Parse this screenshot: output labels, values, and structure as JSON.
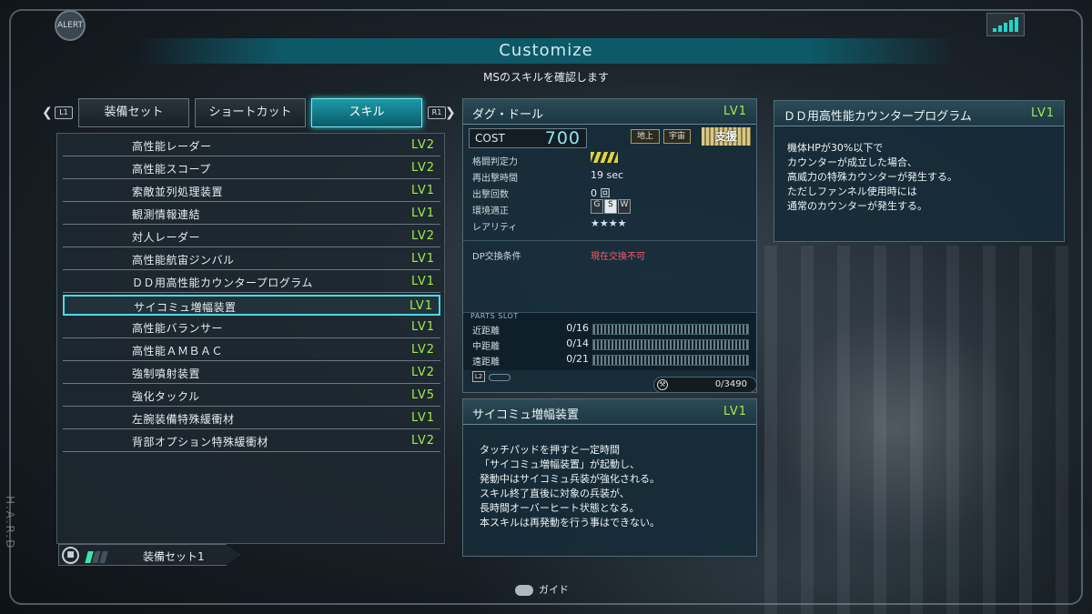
{
  "header": {
    "alert": "ALERT",
    "title": "Customize",
    "subtitle": "MSのスキルを確認します"
  },
  "tabs": {
    "left_button": "L1",
    "right_button": "R1",
    "items": [
      {
        "label": "装備セット"
      },
      {
        "label": "ショートカット"
      },
      {
        "label": "スキル",
        "active": true
      }
    ]
  },
  "skills": [
    {
      "name": "高性能レーダー",
      "level": "LV2"
    },
    {
      "name": "高性能スコープ",
      "level": "LV2"
    },
    {
      "name": "索敵並列処理装置",
      "level": "LV1"
    },
    {
      "name": "観測情報連結",
      "level": "LV1"
    },
    {
      "name": "対人レーダー",
      "level": "LV2"
    },
    {
      "name": "高性能航宙ジンバル",
      "level": "LV1"
    },
    {
      "name": "ＤＤ用高性能カウンタープログラム",
      "level": "LV1"
    },
    {
      "name": "サイコミュ増幅装置",
      "level": "LV1",
      "selected": true
    },
    {
      "name": "高性能バランサー",
      "level": "LV1"
    },
    {
      "name": "高性能ＡＭＢＡＣ",
      "level": "LV2"
    },
    {
      "name": "強制噴射装置",
      "level": "LV2"
    },
    {
      "name": "強化タックル",
      "level": "LV5"
    },
    {
      "name": "左腕装備特殊緩衝材",
      "level": "LV1"
    },
    {
      "name": "背部オプション特殊緩衝材",
      "level": "LV2"
    }
  ],
  "loadout": {
    "label": "装備セット1",
    "filled_bars": 1,
    "total_bars": 3
  },
  "ms": {
    "name": "ダグ・ドール",
    "level": "LV1",
    "cost_label": "COST",
    "cost": "700",
    "env_ground": "地上",
    "env_space": "宇宙",
    "type": "支援",
    "stats": [
      {
        "label": "格闘判定力",
        "value": ""
      },
      {
        "label": "再出撃時間",
        "value": "19 sec"
      },
      {
        "label": "出撃回数",
        "value": "0 回"
      },
      {
        "label": "環境適正",
        "value": ""
      },
      {
        "label": "レアリティ",
        "value": "★★★★"
      }
    ],
    "env_grades": [
      "G",
      "S",
      "W"
    ],
    "dp_label": "DP交換条件",
    "dp_value": "現在交換不可",
    "parts_title": "PARTS SLOT",
    "parts": [
      {
        "label": "近距離",
        "count": "0/16",
        "fill": 0
      },
      {
        "label": "中距離",
        "count": "0/14",
        "fill": 0
      },
      {
        "label": "遠距離",
        "count": "0/21",
        "fill": 0
      }
    ],
    "l2_button": "L2",
    "parts_counter": "0/3490"
  },
  "selected_skill": {
    "name": "サイコミュ増幅装置",
    "level": "LV1",
    "description": "タッチパッドを押すと一定時間\n「サイコミュ増幅装置」が起動し、\n発動中はサイコミュ兵装が強化される。\nスキル終了直後に対象の兵装が、\n長時間オーバーヒート状態となる。\n本スキルは再発動を行う事はできない。"
  },
  "right_panel": {
    "name": "ＤＤ用高性能カウンタープログラム",
    "level": "LV1",
    "description": "機体HPが30%以下で\nカウンターが成立した場合、\n高威力の特殊カウンターが発生する。\nただしファンネル使用時には\n通常のカウンターが発生する。"
  },
  "footer": {
    "guide_label": "ガイド",
    "side_label": "H.A.R.D"
  },
  "colors": {
    "accent": "#47dce6",
    "level": "#9fec4a",
    "warning": "#ff5a6a"
  }
}
